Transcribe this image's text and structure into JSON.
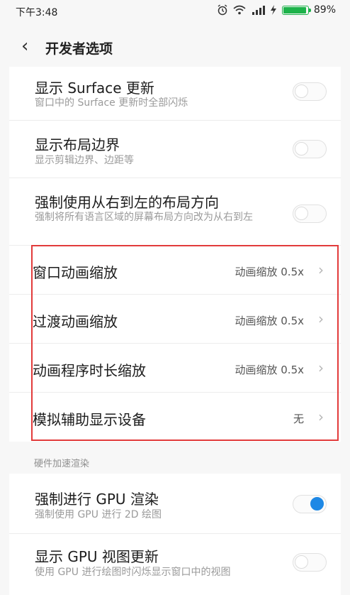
{
  "status": {
    "time": "下午3:48",
    "battery_pct": "89%"
  },
  "header": {
    "back_glyph": "‹",
    "title": "开发者选项"
  },
  "rows1": [
    {
      "title": "显示 Surface 更新",
      "subtitle": "窗口中的 Surface 更新时全部闪烁",
      "toggle_on": false
    },
    {
      "title": "显示布局边界",
      "subtitle": "显示剪辑边界、边距等",
      "toggle_on": false
    },
    {
      "title": "强制使用从右到左的布局方向",
      "subtitle": "强制将所有语言区域的屏幕布局方向改为从右到左",
      "toggle_on": false
    }
  ],
  "nav": [
    {
      "title": "窗口动画缩放",
      "value": "动画缩放 0.5x"
    },
    {
      "title": "过渡动画缩放",
      "value": "动画缩放 0.5x"
    },
    {
      "title": "动画程序时长缩放",
      "value": "动画缩放 0.5x"
    },
    {
      "title": "模拟辅助显示设备",
      "value": "无"
    }
  ],
  "section": {
    "label": "硬件加速渲染"
  },
  "rows2": [
    {
      "title": "强制进行 GPU 渲染",
      "subtitle": "强制使用 GPU 进行 2D 绘图",
      "toggle_on": true
    },
    {
      "title": "显示 GPU 视图更新",
      "subtitle": "使用 GPU 进行绘图时闪烁显示窗口中的视图",
      "toggle_on": false
    }
  ],
  "colors": {
    "accent": "#1e88e5",
    "battery": "#1db24a",
    "highlight": "#e23b3b"
  }
}
